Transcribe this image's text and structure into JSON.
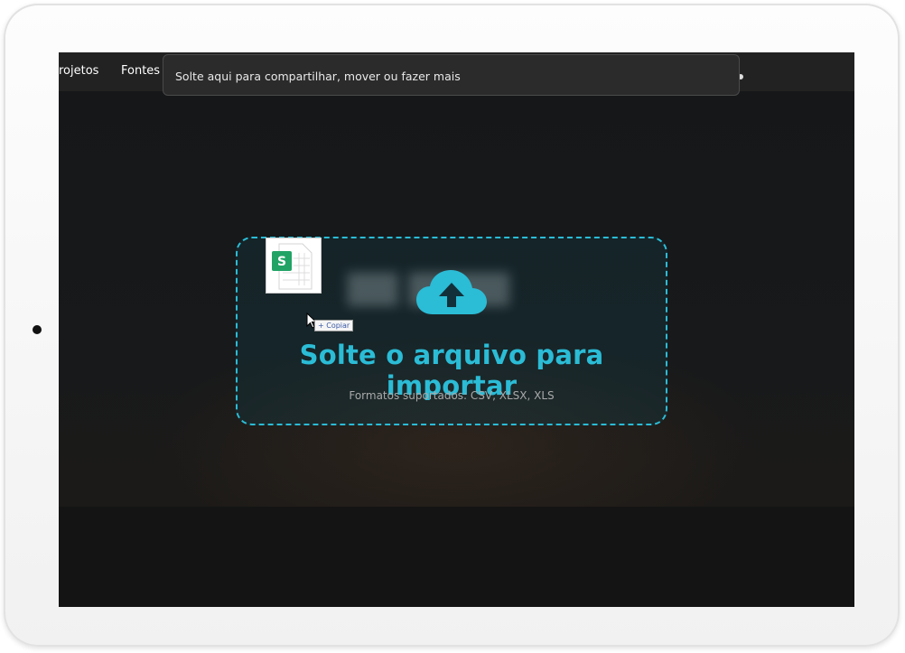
{
  "nav": {
    "items": [
      {
        "label": "rojetos"
      },
      {
        "label": "Fontes d"
      }
    ]
  },
  "share_tooltip": {
    "text": "Solte aqui para compartilhar, mover ou fazer mais"
  },
  "dropzone": {
    "title": "Solte o arquivo para importar",
    "formats": "Formatos suportados: CSV, XLSX, XLS",
    "icon": "cloud-upload-icon",
    "accent_color": "#2bbcd6"
  },
  "drag": {
    "file_icon": "spreadsheet-file-icon",
    "file_letter": "S",
    "badge_label": "Copiar"
  },
  "colors": {
    "background": "#141414",
    "nav_background": "#222222",
    "file_green": "#21a366"
  }
}
